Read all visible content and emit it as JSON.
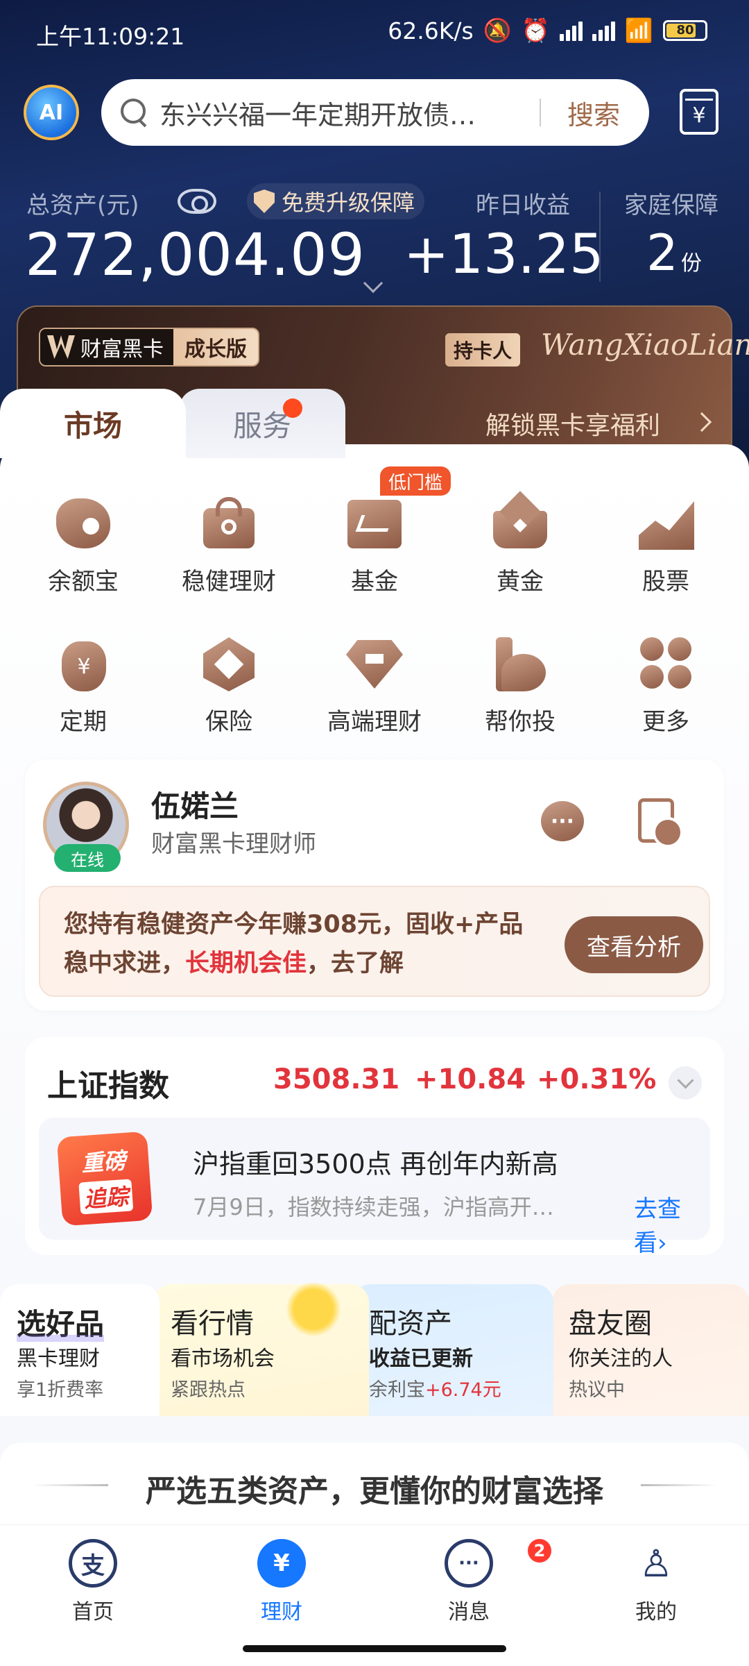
{
  "status_bar": {
    "time": "上午11:09:21",
    "net_speed": "62.6K/s",
    "battery": "80"
  },
  "search": {
    "placeholder": "东兴兴福一年定期开放债…",
    "button": "搜索"
  },
  "assets": {
    "total_label": "总资产(元)",
    "total_value": "272,004.09",
    "upgrade_label": "免费升级保障",
    "yesterday_label": "昨日收益",
    "yesterday_value": "+13.25",
    "family_label": "家庭保障",
    "family_value": "2",
    "family_unit": "份"
  },
  "black_card": {
    "brand": "财富黑卡",
    "level": "成长版",
    "holder_label": "持卡人",
    "holder_name": "WangXiaoLian",
    "unlock_text": "解锁黑卡享福利"
  },
  "tabs": {
    "market": "市场",
    "service": "服务"
  },
  "grid": {
    "row1": [
      {
        "label": "余额宝",
        "icon": "yuebao-icon"
      },
      {
        "label": "稳健理财",
        "icon": "stable-finance-icon"
      },
      {
        "label": "基金",
        "icon": "fund-icon",
        "badge": "低门槛"
      },
      {
        "label": "黄金",
        "icon": "gold-icon"
      },
      {
        "label": "股票",
        "icon": "stock-icon"
      }
    ],
    "row2": [
      {
        "label": "定期",
        "icon": "fixed-term-icon"
      },
      {
        "label": "保险",
        "icon": "insurance-icon"
      },
      {
        "label": "高端理财",
        "icon": "premium-finance-icon"
      },
      {
        "label": "帮你投",
        "icon": "help-invest-icon"
      },
      {
        "label": "更多",
        "icon": "more-icon"
      }
    ]
  },
  "advisor": {
    "name": "伍婼兰",
    "title": "财富黑卡理财师",
    "status": "在线",
    "advice_part1": "您持有稳健资产今年赚308元，固收+产品稳中求进，",
    "advice_red": "长期机会佳",
    "advice_part2": "，去了解",
    "button": "查看分析"
  },
  "index": {
    "name": "上证指数",
    "value": "3508.31",
    "change": "+10.84",
    "percent": "+0.31%",
    "badge_line1": "重磅",
    "badge_line2": "追踪",
    "news_title": "沪指重回3500点 再创年内新高",
    "news_sub": "7月9日，指数持续走强，沪指高开…",
    "news_link": "去查看"
  },
  "features": [
    {
      "title": "选好品",
      "sub": "黑卡理财",
      "mini": "享1折费率"
    },
    {
      "title": "看行情",
      "sub": "看市场机会",
      "mini": "紧跟热点"
    },
    {
      "title": "配资产",
      "sub": "收益已更新",
      "mini_prefix": "余利宝",
      "mini_value": "+6.74元"
    },
    {
      "title": "盘友圈",
      "sub": "你关注的人",
      "mini": "热议中"
    }
  ],
  "select_banner": "严选五类资产，更懂你的财富选择",
  "bottom_nav": [
    {
      "label": "首页",
      "glyph": "支"
    },
    {
      "label": "理财",
      "glyph": "¥"
    },
    {
      "label": "消息",
      "glyph": "···",
      "badge": "2"
    },
    {
      "label": "我的",
      "glyph": "♙"
    }
  ],
  "colors": {
    "accent_brown": "#8a5a45",
    "red": "#e2343c",
    "blue": "#1677ff",
    "hero_bg": "#14254f"
  }
}
